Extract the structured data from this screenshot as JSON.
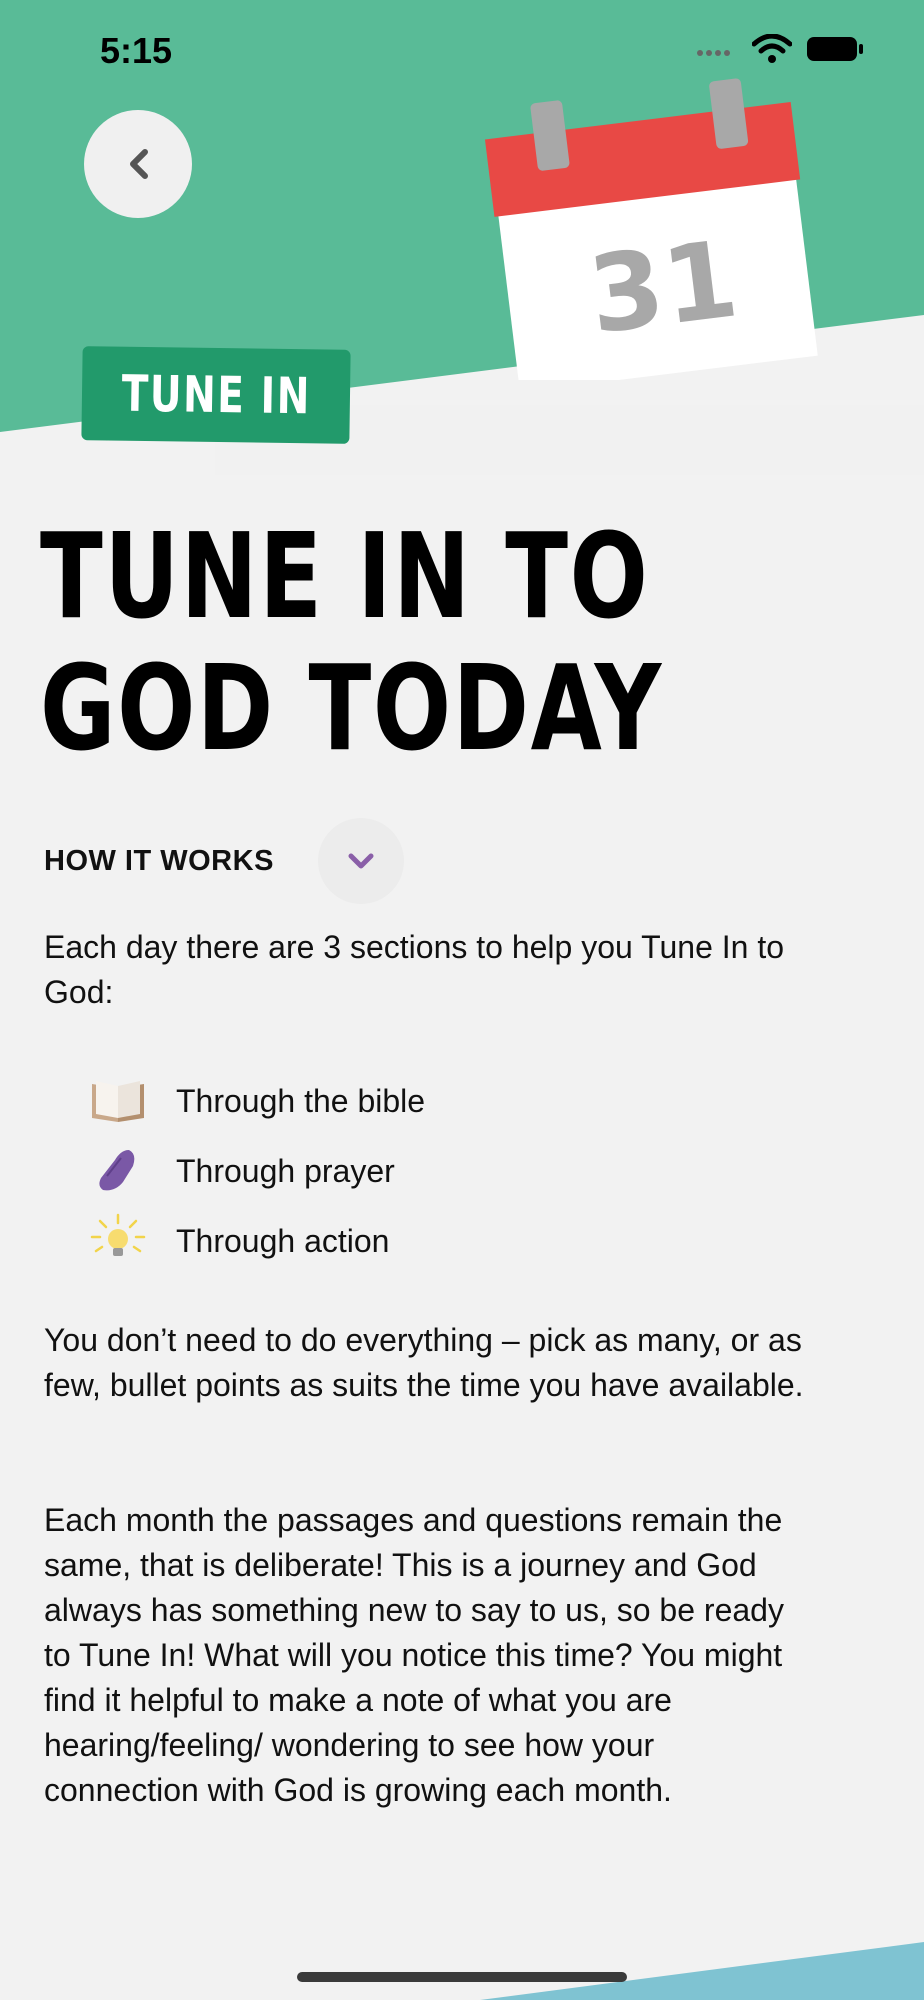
{
  "status_bar": {
    "time": "5:15"
  },
  "header": {
    "calendar_day": "31",
    "tag_label": "TUNE IN",
    "colors": {
      "green": "#59bb97",
      "red": "#e84945",
      "tag": "#229a6b"
    }
  },
  "main": {
    "title_line1": "TUNE IN TO",
    "title_line2": "GOD TODAY",
    "how_it_works_label": "HOW IT WORKS",
    "intro": "Each day there are 3 sections to help you Tune In to God:",
    "sections": [
      {
        "icon": "book-icon",
        "label": "Through the bible"
      },
      {
        "icon": "praying-hands-icon",
        "label": "Through prayer"
      },
      {
        "icon": "lightbulb-icon",
        "label": "Through action"
      }
    ],
    "paragraph1": "You don’t need to do everything – pick as many, or as few, bullet points as suits the time you have available.",
    "paragraph2": "Each month the passages and questions remain the same, that is deliberate! This is a journey and God always has something new to say to us, so be ready to Tune In! What will you notice this time? You might find it helpful to make a note of what you are hearing/feeling/ wondering to see how your connection with God is growing each month."
  }
}
